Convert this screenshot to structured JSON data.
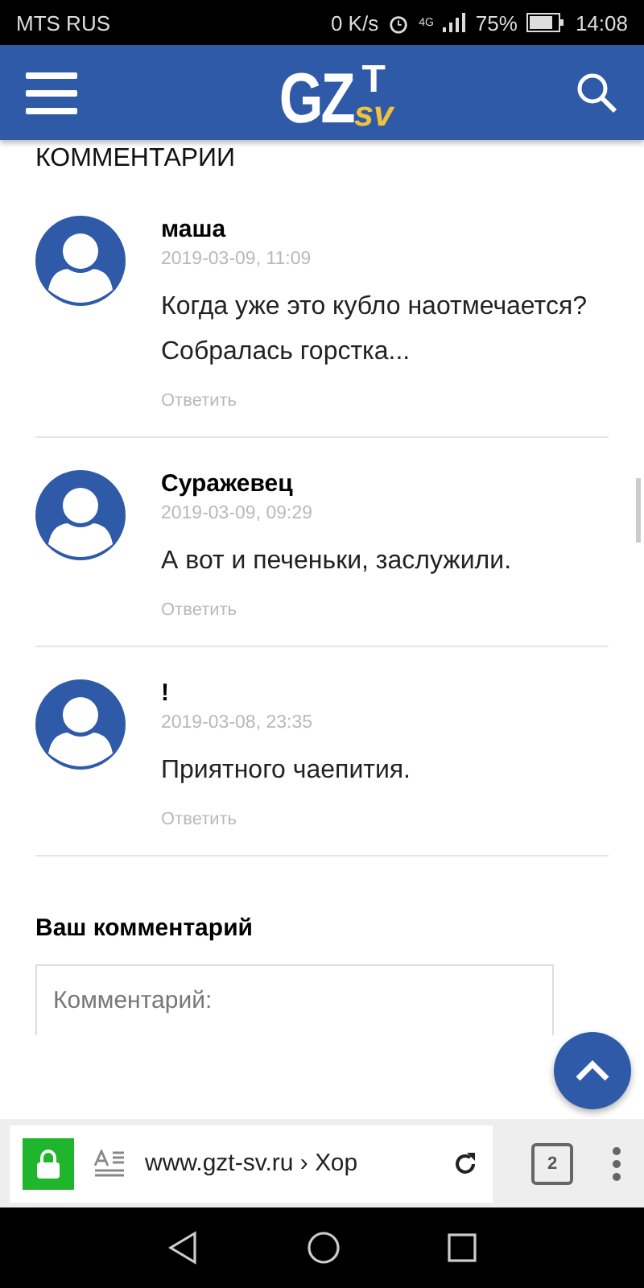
{
  "status_bar": {
    "carrier": "MTS RUS",
    "speed": "0 K/s",
    "network": "4G",
    "battery": "75%",
    "time": "14:08"
  },
  "header": {
    "logo": {
      "main": "GZ",
      "top": "T",
      "sub": "sv"
    }
  },
  "section_title": "КОММЕНТАРИИ",
  "comments": [
    {
      "author": "маша",
      "date": "2019-03-09, 11:09",
      "text": "Когда уже это кубло наотмечается? Собралась горстка...",
      "reply": "Ответить"
    },
    {
      "author": "Суражевец",
      "date": "2019-03-09, 09:29",
      "text": "А вот и печеньки, заслужили.",
      "reply": "Ответить"
    },
    {
      "author": "!",
      "date": "2019-03-08, 23:35",
      "text": "Приятного чаепития.",
      "reply": "Ответить"
    }
  ],
  "comment_form": {
    "title": "Ваш комментарий",
    "placeholder": "Комментарий:"
  },
  "browser_bar": {
    "url": "www.gzt-sv.ru › Хор",
    "tabs": "2"
  }
}
